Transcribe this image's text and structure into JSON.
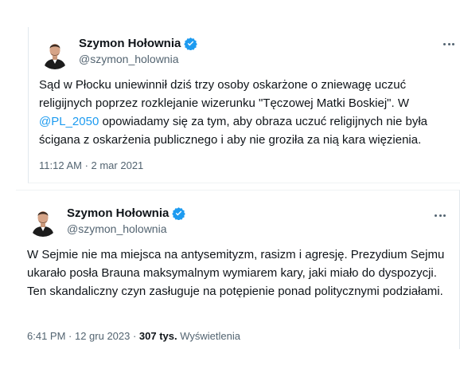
{
  "tweets": [
    {
      "author_name": "Szymon Hołownia",
      "author_handle": "@szymon_holownia",
      "verified_icon": "verified-badge-icon",
      "more_icon": "more-options-icon",
      "text_before_mention": "Sąd w Płocku uniewinnił dziś trzy osoby oskarżone o zniewagę uczuć religijnych poprzez rozklejanie wizerunku \"Tęczowej Matki Boskiej\". W ",
      "mention": "@PL_2050",
      "text_after_mention": " opowiadamy się za tym, aby obraza uczuć religijnych nie była ścigana z oskarżenia publicznego i aby nie groziła za nią kara więzienia.",
      "timestamp": "11:12 AM · 2 mar 2021"
    },
    {
      "author_name": "Szymon Hołownia",
      "author_handle": "@szymon_holownia",
      "verified_icon": "verified-badge-icon",
      "more_icon": "more-options-icon",
      "text": "W Sejmie nie ma miejsca na antysemityzm, rasizm i agresję. Prezydium Sejmu ukarało posła Brauna maksymalnym wymiarem kary, jaki miało do dyspozycji. Ten skandaliczny czyn zasługuje na potępienie ponad politycznymi podziałami.",
      "timestamp": "6:41 PM · 12 gru 2023 · ",
      "views_count": "307 tys.",
      "views_label": " Wyświetlenia"
    }
  ],
  "colors": {
    "verified": "#1d9bf0",
    "mention": "#1d9bf0",
    "secondary_text": "#536471",
    "primary_text": "#0f1419"
  }
}
